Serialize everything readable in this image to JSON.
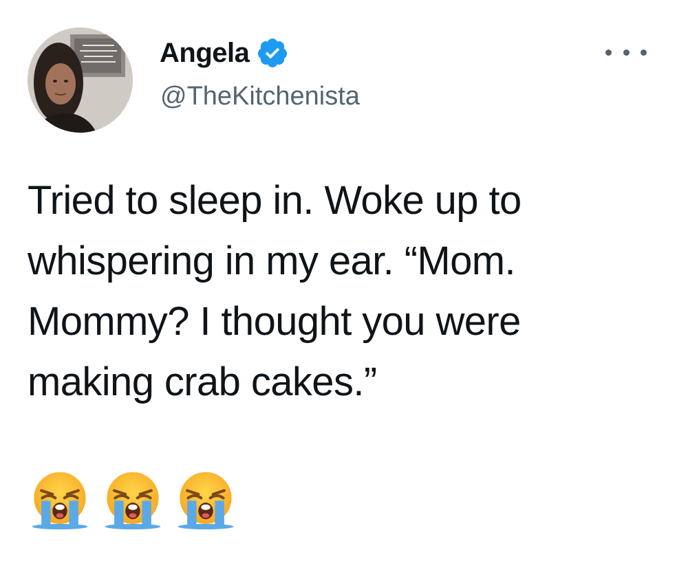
{
  "author": {
    "display_name": "Angela",
    "handle": "@TheKitchenista",
    "verified": true
  },
  "tweet": {
    "text": "Tried to sleep in. Woke up to\nwhispering in my ear. “Mom.\nMommy? I thought you were\nmaking crab cakes.”",
    "emojis": [
      "loudly-crying-face",
      "loudly-crying-face",
      "loudly-crying-face"
    ]
  },
  "colors": {
    "text": "#0f1419",
    "secondary": "#536471",
    "verified_badge": "#1d9bf0",
    "emoji_face": "#ffc83d",
    "emoji_tears": "#5aa9e6"
  },
  "icons": {
    "verified": "verified-badge-icon",
    "more": "more-options-icon"
  }
}
